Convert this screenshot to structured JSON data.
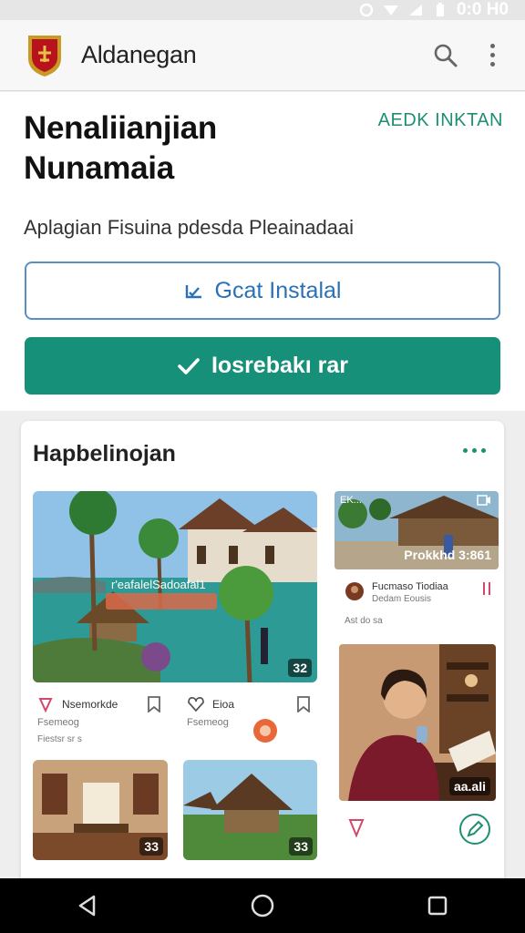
{
  "status_bar": {
    "time": "0:0 H0",
    "icons": [
      "sync-icon",
      "wifi-icon",
      "signal-icon",
      "battery-icon"
    ]
  },
  "app_bar": {
    "title": "Aldanegan",
    "icons": [
      "crest-logo",
      "search-icon",
      "more-vert-icon"
    ]
  },
  "hero": {
    "title": "Nenaliianjian Nunamaia",
    "link": "AEDK INKTAN",
    "subtitle": "Aplagian Fisuina pdesda Pleainadaai",
    "outline_button": "Gcat Instalal",
    "primary_button": "Iosrebakı rar"
  },
  "card": {
    "title": "Hapbelinojan",
    "items": [
      {
        "overlay": "r'eafalelSadoafal1",
        "count": "32"
      },
      {
        "count": "33",
        "action_title": "Eioa",
        "action_sub": "Fsemeog"
      },
      {
        "count": "33"
      },
      {
        "count": "33"
      },
      {
        "overlay": "Prokkhd 3:861",
        "top_tag": "EK..."
      },
      {
        "title": "Fucmaso Tiodiaa",
        "subtitle": "Dedam Eousis",
        "meta": "Ast do sa"
      },
      {
        "badge": "aa.ali"
      }
    ],
    "left_caption_title": "Nsemorkde",
    "left_caption_sub": "Fsemeog",
    "left_caption_meta": "Fiestsr sr s"
  },
  "colors": {
    "accent": "#17907a",
    "link": "#2a72b5"
  }
}
